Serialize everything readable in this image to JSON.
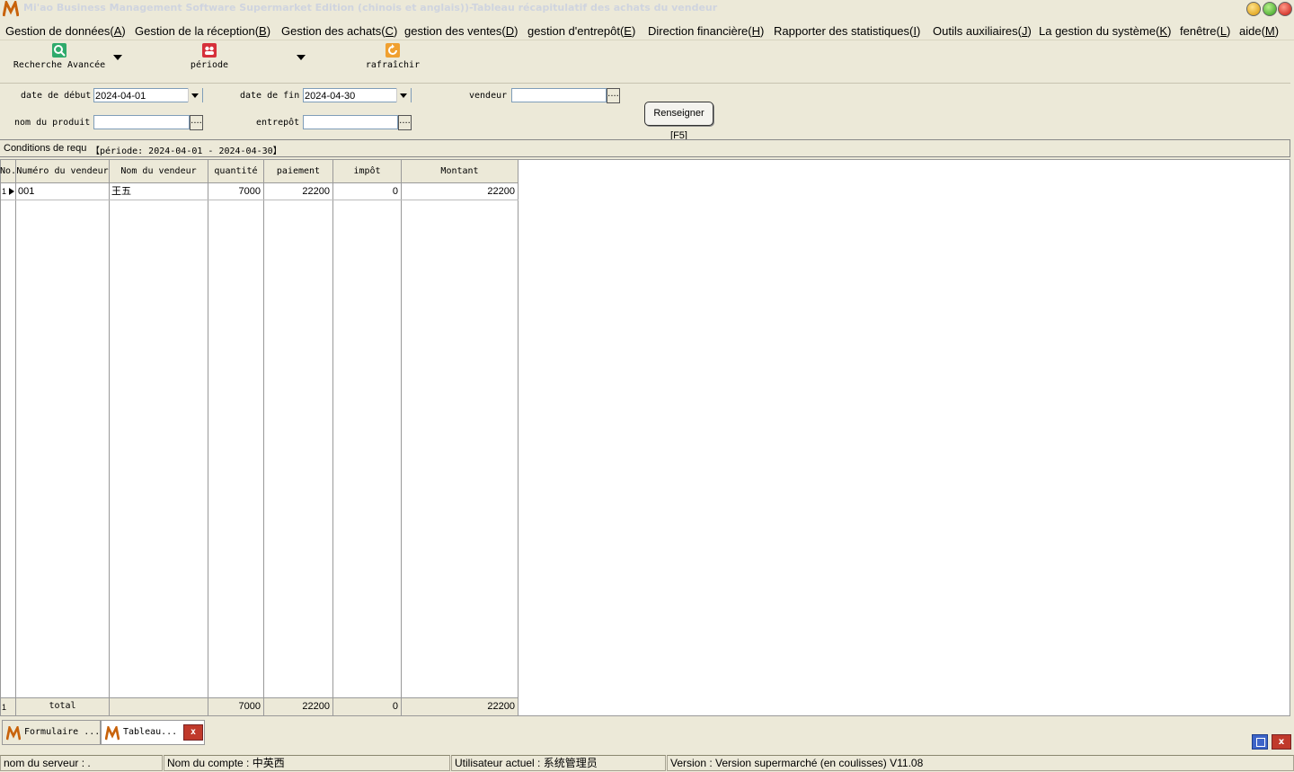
{
  "window": {
    "title": "Mi'ao Business Management Software Supermarket Edition (chinois et anglais))-Tableau récapitulatif des achats du vendeur"
  },
  "menu": [
    {
      "label": "Gestion de données(",
      "key": "A",
      "suffix": ")"
    },
    {
      "label": "Gestion de la réception(",
      "key": "B",
      "suffix": ")"
    },
    {
      "label": "Gestion des achats(",
      "key": "C",
      "suffix": ")"
    },
    {
      "label": "gestion des ventes(",
      "key": "D",
      "suffix": ")"
    },
    {
      "label": "gestion d'entrepôt(",
      "key": "E",
      "suffix": ")"
    },
    {
      "label": "Direction financière(",
      "key": "H",
      "suffix": ")"
    },
    {
      "label": "Rapporter des statistiques(",
      "key": "I",
      "suffix": ")"
    },
    {
      "label": "Outils auxiliaires(",
      "key": "J",
      "suffix": ")"
    },
    {
      "label": "La gestion du système(",
      "key": "K",
      "suffix": ")"
    },
    {
      "label": "fenêtre(",
      "key": "L",
      "suffix": ")"
    },
    {
      "label": "aide(",
      "key": "M",
      "suffix": ")"
    }
  ],
  "toolbar": {
    "advanced_search": "Recherche Avancée",
    "period": "période",
    "refresh": "rafraîchir"
  },
  "query": {
    "start_label": "date de début",
    "start_value": "2024-04-01",
    "end_label": "date de fin",
    "end_value": "2024-04-30",
    "vendor_label": "vendeur",
    "vendor_value": "",
    "product_label": "nom du produit",
    "product_value": "",
    "warehouse_label": "entrepôt",
    "warehouse_value": "",
    "ellipsis": "....",
    "search_button": "Renseigner [F5]"
  },
  "conditions": {
    "label": "Conditions de requ",
    "value": "【période: 2024-04-01 - 2024-04-30】"
  },
  "grid": {
    "columns": [
      "No.",
      "Numéro du vendeur",
      "Nom du vendeur",
      "quantité",
      "paiement",
      "impôt",
      "Montant"
    ],
    "rows": [
      {
        "no": "1",
        "vendor_no": "001",
        "vendor_name": "王五",
        "quantity": "7000",
        "payment": "22200",
        "tax": "0",
        "amount": "22200"
      }
    ],
    "footer": {
      "no": "1",
      "label": "total",
      "quantity": "7000",
      "payment": "22200",
      "tax": "0",
      "amount": "22200"
    }
  },
  "tabs": [
    {
      "label": "Formulaire ..."
    },
    {
      "label": "Tableau..."
    }
  ],
  "tab_close": "x",
  "status": {
    "server": "nom du serveur : .",
    "account": "Nom du compte : 中英西",
    "user": "Utilisateur actuel : 系统管理员",
    "version": "Version : Version supermarché (en coulisses) V11.08"
  },
  "colors": {
    "chrome": "#ece9d8",
    "search_icon": "#2eaa6b",
    "period_icon": "#d6303a",
    "refresh_icon": "#f0a030",
    "close": "#c0392b"
  }
}
